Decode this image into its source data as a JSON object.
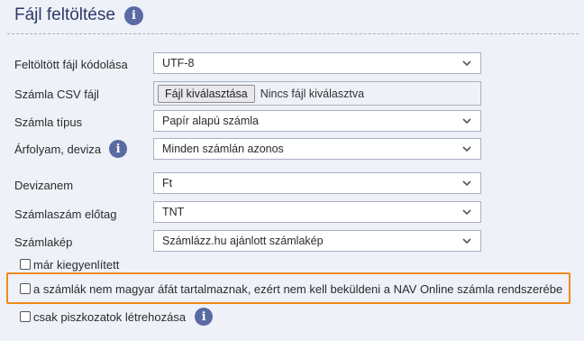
{
  "section": {
    "title": "Fájl feltöltése"
  },
  "form": {
    "encoding": {
      "label": "Feltöltött fájl kódolása",
      "value": "UTF-8"
    },
    "csv": {
      "label": "Számla CSV fájl",
      "button": "Fájl kiválasztása",
      "status": "Nincs fájl kiválasztva"
    },
    "invoice_type": {
      "label": "Számla típus",
      "value": "Papír alapú számla"
    },
    "exchange": {
      "label": "Árfolyam, deviza",
      "value": "Minden számlán azonos"
    },
    "currency": {
      "label": "Devizanem",
      "value": "Ft"
    },
    "prefix": {
      "label": "Számlaszám előtag",
      "value": "TNT"
    },
    "template": {
      "label": "Számlakép",
      "value": "Számlázz.hu ajánlott számlakép"
    }
  },
  "checkboxes": {
    "paid": {
      "label": "már kiegyenlített",
      "checked": false
    },
    "no_nav": {
      "label": "a számlák nem magyar áfát tartalmaznak, ezért nem kell beküldeni a NAV Online számla rendszerébe",
      "checked": false
    },
    "drafts": {
      "label": "csak piszkozatok létrehozása",
      "checked": false
    }
  },
  "colors": {
    "highlight": "#f08a1c",
    "info_icon": "#5a6aa3",
    "title": "#2f3a66"
  },
  "icons": {
    "info": "info-icon",
    "chevron": "chevron-down-icon"
  }
}
